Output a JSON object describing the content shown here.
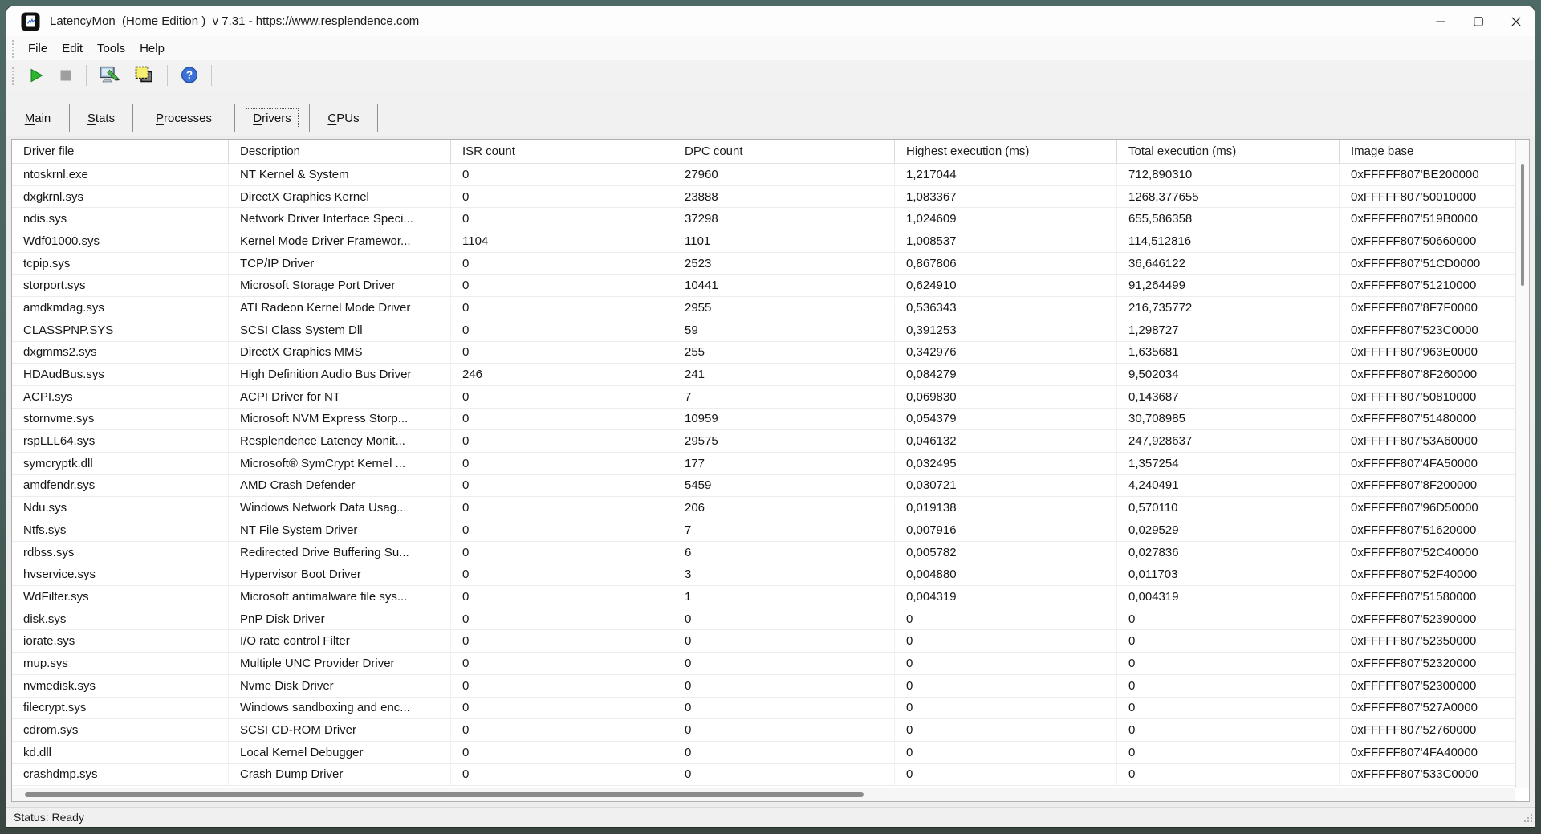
{
  "window": {
    "title": "LatencyMon  (Home Edition )  v 7.31 - https://www.resplendence.com"
  },
  "icons": {
    "app": "latencymon-app-icon",
    "minimize": "minimize-icon",
    "maximize": "maximize-icon",
    "close": "close-icon",
    "play": "play-icon",
    "stop": "stop-icon",
    "tools": "monitor-pen-icon",
    "copy": "copy-report-icon",
    "help": "help-question-icon",
    "gripper": "drag-gripper",
    "resize": "resize-grip-icon"
  },
  "menu": {
    "items": [
      {
        "accel": "F",
        "rest": "ile"
      },
      {
        "accel": "E",
        "rest": "dit"
      },
      {
        "accel": "T",
        "rest": "ools"
      },
      {
        "accel": "H",
        "rest": "elp"
      }
    ]
  },
  "tabs": [
    {
      "accel": "M",
      "rest": "ain",
      "selected": false
    },
    {
      "accel": "S",
      "rest": "tats",
      "selected": false
    },
    {
      "accel": "P",
      "rest": "rocesses",
      "selected": false
    },
    {
      "accel": "D",
      "rest": "rivers",
      "selected": true
    },
    {
      "accel": "C",
      "rest": "PUs",
      "selected": false
    }
  ],
  "table": {
    "columns": [
      "Driver file",
      "Description",
      "ISR count",
      "DPC count",
      "Highest execution (ms)",
      "Total execution (ms)",
      "Image base"
    ],
    "rows": [
      [
        "ntoskrnl.exe",
        "NT Kernel & System",
        "0",
        "27960",
        "1,217044",
        "712,890310",
        "0xFFFFF807'BE200000"
      ],
      [
        "dxgkrnl.sys",
        "DirectX Graphics Kernel",
        "0",
        "23888",
        "1,083367",
        "1268,377655",
        "0xFFFFF807'50010000"
      ],
      [
        "ndis.sys",
        "Network Driver Interface Speci...",
        "0",
        "37298",
        "1,024609",
        "655,586358",
        "0xFFFFF807'519B0000"
      ],
      [
        "Wdf01000.sys",
        "Kernel Mode Driver Framewor...",
        "1104",
        "1101",
        "1,008537",
        "114,512816",
        "0xFFFFF807'50660000"
      ],
      [
        "tcpip.sys",
        "TCP/IP Driver",
        "0",
        "2523",
        "0,867806",
        "36,646122",
        "0xFFFFF807'51CD0000"
      ],
      [
        "storport.sys",
        "Microsoft Storage Port Driver",
        "0",
        "10441",
        "0,624910",
        "91,264499",
        "0xFFFFF807'51210000"
      ],
      [
        "amdkmdag.sys",
        "ATI Radeon Kernel Mode Driver",
        "0",
        "2955",
        "0,536343",
        "216,735772",
        "0xFFFFF807'8F7F0000"
      ],
      [
        "CLASSPNP.SYS",
        "SCSI Class System Dll",
        "0",
        "59",
        "0,391253",
        "1,298727",
        "0xFFFFF807'523C0000"
      ],
      [
        "dxgmms2.sys",
        "DirectX Graphics MMS",
        "0",
        "255",
        "0,342976",
        "1,635681",
        "0xFFFFF807'963E0000"
      ],
      [
        "HDAudBus.sys",
        "High Definition Audio Bus Driver",
        "246",
        "241",
        "0,084279",
        "9,502034",
        "0xFFFFF807'8F260000"
      ],
      [
        "ACPI.sys",
        "ACPI Driver for NT",
        "0",
        "7",
        "0,069830",
        "0,143687",
        "0xFFFFF807'50810000"
      ],
      [
        "stornvme.sys",
        "Microsoft NVM Express Storp...",
        "0",
        "10959",
        "0,054379",
        "30,708985",
        "0xFFFFF807'51480000"
      ],
      [
        "rspLLL64.sys",
        "Resplendence Latency Monit...",
        "0",
        "29575",
        "0,046132",
        "247,928637",
        "0xFFFFF807'53A60000"
      ],
      [
        "symcryptk.dll",
        "Microsoft® SymCrypt Kernel ...",
        "0",
        "177",
        "0,032495",
        "1,357254",
        "0xFFFFF807'4FA50000"
      ],
      [
        "amdfendr.sys",
        "AMD Crash Defender",
        "0",
        "5459",
        "0,030721",
        "4,240491",
        "0xFFFFF807'8F200000"
      ],
      [
        "Ndu.sys",
        "Windows Network Data Usag...",
        "0",
        "206",
        "0,019138",
        "0,570110",
        "0xFFFFF807'96D50000"
      ],
      [
        "Ntfs.sys",
        "NT File System Driver",
        "0",
        "7",
        "0,007916",
        "0,029529",
        "0xFFFFF807'51620000"
      ],
      [
        "rdbss.sys",
        "Redirected Drive Buffering Su...",
        "0",
        "6",
        "0,005782",
        "0,027836",
        "0xFFFFF807'52C40000"
      ],
      [
        "hvservice.sys",
        "Hypervisor Boot Driver",
        "0",
        "3",
        "0,004880",
        "0,011703",
        "0xFFFFF807'52F40000"
      ],
      [
        "WdFilter.sys",
        "Microsoft antimalware file sys...",
        "0",
        "1",
        "0,004319",
        "0,004319",
        "0xFFFFF807'51580000"
      ],
      [
        "disk.sys",
        "PnP Disk Driver",
        "0",
        "0",
        "0",
        "0",
        "0xFFFFF807'52390000"
      ],
      [
        "iorate.sys",
        "I/O rate control Filter",
        "0",
        "0",
        "0",
        "0",
        "0xFFFFF807'52350000"
      ],
      [
        "mup.sys",
        "Multiple UNC Provider Driver",
        "0",
        "0",
        "0",
        "0",
        "0xFFFFF807'52320000"
      ],
      [
        "nvmedisk.sys",
        "Nvme Disk Driver",
        "0",
        "0",
        "0",
        "0",
        "0xFFFFF807'52300000"
      ],
      [
        "filecrypt.sys",
        "Windows sandboxing and enc...",
        "0",
        "0",
        "0",
        "0",
        "0xFFFFF807'527A0000"
      ],
      [
        "cdrom.sys",
        "SCSI CD-ROM Driver",
        "0",
        "0",
        "0",
        "0",
        "0xFFFFF807'52760000"
      ],
      [
        "kd.dll",
        "Local Kernel Debugger",
        "0",
        "0",
        "0",
        "0",
        "0xFFFFF807'4FA40000"
      ],
      [
        "crashdmp.sys",
        "Crash Dump Driver",
        "0",
        "0",
        "0",
        "0",
        "0xFFFFF807'533C0000"
      ]
    ]
  },
  "status": {
    "text": "Status: Ready"
  },
  "colors": {
    "play_green": "#2db52d",
    "help_blue": "#3a72d8",
    "copy_yellow": "#f5ee71",
    "desktop_teal": "#47605c",
    "focus_dotted": "#555555"
  }
}
